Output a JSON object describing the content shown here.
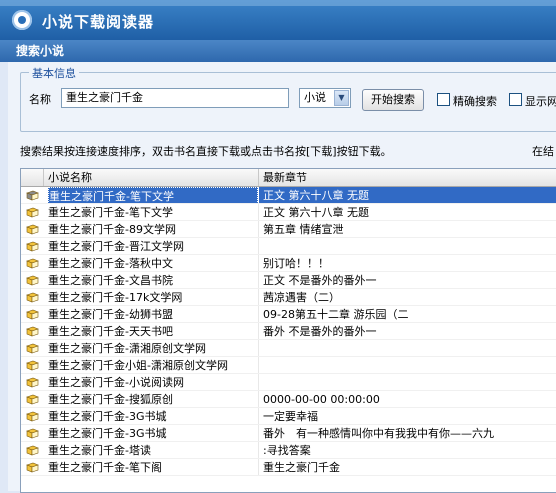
{
  "app": {
    "title": "小说下载阅读器"
  },
  "dialog": {
    "title": "搜索小说"
  },
  "search": {
    "group_label": "基本信息",
    "name_label": "名称",
    "name_value": "重生之豪门千金",
    "type_value": "小说",
    "search_button": "开始搜索",
    "exact_label": "精确搜索",
    "show_label": "显示网址"
  },
  "info": {
    "sort_note": "搜索结果按连接速度排序，双击书名直接下载或点击书名按[下载]按钮下载。",
    "right_note": "在结"
  },
  "table": {
    "col_name": "小说名称",
    "col_chapter": "最新章节",
    "rows": [
      {
        "name": "重生之豪门千金-笔下文学",
        "chapter": "正文 第六十八章 无题",
        "selected": true
      },
      {
        "name": "重生之豪门千金-笔下文学",
        "chapter": "正文 第六十八章 无题",
        "selected": false
      },
      {
        "name": "重生之豪门千金-89文学网",
        "chapter": "第五章 情绪宣泄",
        "selected": false
      },
      {
        "name": "重生之豪门千金-晋江文学网",
        "chapter": "",
        "selected": false
      },
      {
        "name": "重生之豪门千金-落秋中文",
        "chapter": "别订哈！！！",
        "selected": false
      },
      {
        "name": "重生之豪门千金-文昌书院",
        "chapter": "正文 不是番外的番外一",
        "selected": false
      },
      {
        "name": "重生之豪门千金-17k文学网",
        "chapter": "茜凉遇害（二）",
        "selected": false
      },
      {
        "name": "重生之豪门千金-幼狮书盟",
        "chapter": "09-28第五十二章 游乐园（二",
        "selected": false
      },
      {
        "name": "重生之豪门千金-天天书吧",
        "chapter": "番外 不是番外的番外一",
        "selected": false
      },
      {
        "name": "重生之豪门千金-潇湘原创文学网",
        "chapter": "",
        "selected": false
      },
      {
        "name": "重生之豪门千金小姐-潇湘原创文学网",
        "chapter": "",
        "selected": false
      },
      {
        "name": "重生之豪门千金-小说阅读网",
        "chapter": "",
        "selected": false
      },
      {
        "name": "重生之豪门千金-搜狐原创",
        "chapter": "0000-00-00 00:00:00",
        "selected": false
      },
      {
        "name": "重生之豪门千金-3G书城",
        "chapter": "一定要幸福",
        "selected": false
      },
      {
        "name": "重生之豪门千金-3G书城",
        "chapter": "番外　有一种感情叫你中有我我中有你——六九",
        "selected": false
      },
      {
        "name": "重生之豪门千金-塔读",
        "chapter": ":寻找答案",
        "selected": false
      },
      {
        "name": "重生之豪门千金-笔下阁",
        "chapter": "重生之豪门千金",
        "selected": false
      }
    ]
  },
  "colors": {
    "selection": "#316ac5",
    "title_bar": "#2e68ad",
    "book_icon": "#f2c33c"
  }
}
